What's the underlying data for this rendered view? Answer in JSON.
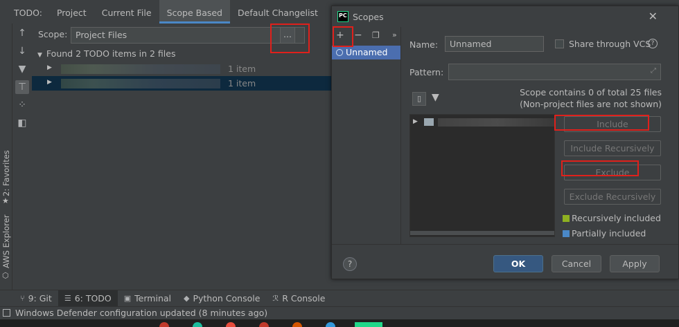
{
  "topbar": {
    "label": "TODO:",
    "tabs": [
      {
        "label": "Project"
      },
      {
        "label": "Current File"
      },
      {
        "label": "Scope Based"
      },
      {
        "label": "Default Changelist"
      }
    ]
  },
  "left_strip": {
    "favorites": "2: Favorites",
    "aws": "AWS Explorer"
  },
  "todo_panel": {
    "scope_label": "Scope:",
    "scope_value": "Project Files",
    "dots_button": "...",
    "found_text": "Found 2 TODO items in 2 files",
    "rows": [
      {
        "count": "1 item"
      },
      {
        "count": "1 item"
      }
    ]
  },
  "dialog": {
    "title": "Scopes",
    "logo_text": "PC",
    "scope_list": [
      {
        "label": "Unnamed"
      }
    ],
    "name_label": "Name:",
    "name_value": "Unnamed",
    "share_label": "Share through VCS",
    "pattern_label": "Pattern:",
    "stats_line1": "Scope contains 0 of total 25 files",
    "stats_line2": "(Non-project files are not shown)",
    "buttons": {
      "include": "Include",
      "include_recursively": "Include Recursively",
      "exclude": "Exclude",
      "exclude_recursively": "Exclude Recursively"
    },
    "legend": [
      {
        "label": "Recursively included",
        "color": "#8eb021"
      },
      {
        "label": "Partially included",
        "color": "#4a88c7"
      }
    ],
    "help": "?",
    "ok": "OK",
    "cancel": "Cancel",
    "apply": "Apply"
  },
  "bottombar": {
    "tabs": [
      {
        "label": "9: Git"
      },
      {
        "label": "6: TODO"
      },
      {
        "label": "Terminal"
      },
      {
        "label": "Python Console"
      },
      {
        "label": "R Console"
      }
    ]
  },
  "status": {
    "text": "Windows Defender configuration updated (8 minutes ago)"
  },
  "colors": {
    "accent": "#4a88c7",
    "selection": "#4b6eaf",
    "highlight": "#e0201b"
  }
}
